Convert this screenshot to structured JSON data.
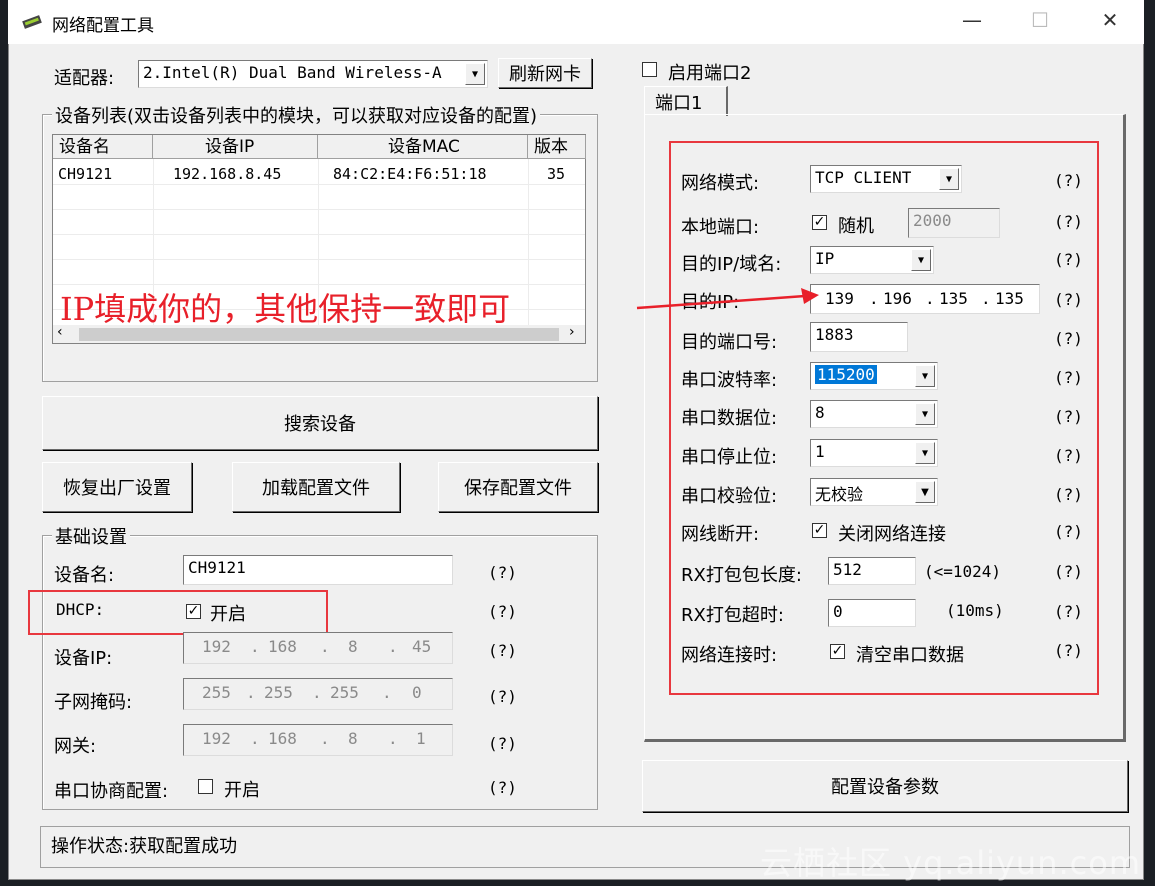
{
  "window": {
    "title": "网络配置工具",
    "controls": {
      "minimize": "—",
      "maximize": "☐",
      "close": "✕"
    }
  },
  "adapter": {
    "label": "适配器:",
    "selected": "2.Intel(R) Dual Band Wireless-A",
    "refresh_button": "刷新网卡"
  },
  "device_list": {
    "group_label": "设备列表(双击设备列表中的模块，可以获取对应设备的配置)",
    "columns": [
      "设备名",
      "设备IP",
      "设备MAC",
      "版本"
    ],
    "rows": [
      [
        "CH9121",
        "192.168.8.45",
        "84:C2:E4:F6:51:18",
        "35"
      ]
    ]
  },
  "buttons": {
    "search": "搜索设备",
    "factory_reset": "恢复出厂设置",
    "load_config": "加载配置文件",
    "save_config": "保存配置文件",
    "apply_config": "配置设备参数"
  },
  "basic": {
    "group_label": "基础设置",
    "device_name_label": "设备名:",
    "device_name": "CH9121",
    "dhcp_label": "DHCP:",
    "dhcp_option": "开启",
    "dhcp_checked": true,
    "device_ip_label": "设备IP:",
    "device_ip": [
      "192",
      "168",
      "8",
      "45"
    ],
    "subnet_label": "子网掩码:",
    "subnet": [
      "255",
      "255",
      "255",
      "0"
    ],
    "gateway_label": "网关:",
    "gateway": [
      "192",
      "168",
      "8",
      "1"
    ],
    "serial_neg_label": "串口协商配置:",
    "serial_neg_option": "开启",
    "serial_neg_checked": false,
    "help": "(?)"
  },
  "port": {
    "enable_port2": "启用端口2",
    "tab": "端口1",
    "net_mode_label": "网络模式:",
    "net_mode": "TCP CLIENT",
    "local_port_label": "本地端口:",
    "random_label": "随机",
    "random_checked": true,
    "local_port": "2000",
    "dest_type_label": "目的IP/域名:",
    "dest_type": "IP",
    "dest_ip_label": "目的IP:",
    "dest_ip": [
      "139",
      "196",
      "135",
      "135"
    ],
    "dest_port_label": "目的端口号:",
    "dest_port": "1883",
    "baud_label": "串口波特率:",
    "baud": "115200",
    "data_bits_label": "串口数据位:",
    "data_bits": "8",
    "stop_bits_label": "串口停止位:",
    "stop_bits": "1",
    "parity_label": "串口校验位:",
    "parity": "无校验",
    "cable_label": "网线断开:",
    "cable_option": "关闭网络连接",
    "cable_checked": true,
    "rx_len_label": "RX打包包长度:",
    "rx_len": "512",
    "rx_len_hint": "(<=1024)",
    "rx_timeout_label": "RX打包超时:",
    "rx_timeout": "0",
    "rx_timeout_hint": "(10ms)",
    "connect_label": "网络连接时:",
    "connect_option": "清空串口数据",
    "connect_checked": true,
    "help": "(?)"
  },
  "annotation": "IP填成你的，其他保持一致即可",
  "status": "操作状态:获取配置成功",
  "watermark": "云栖社区 yq.aliyun.com",
  "colors": {
    "annotation_red": "#e8373e",
    "selection_blue": "#0078d7",
    "window_bg": "#f0f0f0"
  }
}
